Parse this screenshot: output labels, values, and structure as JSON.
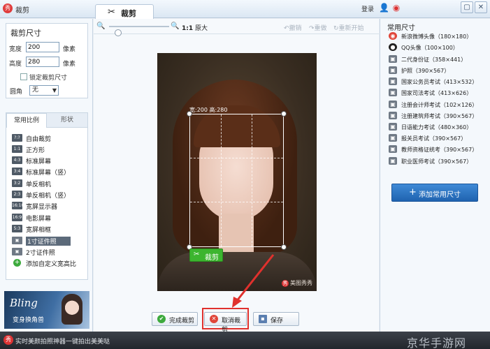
{
  "app": {
    "title": "裁剪",
    "tab_label": "裁剪",
    "login": "登录"
  },
  "size_panel": {
    "title": "裁剪尺寸",
    "width_label": "宽度",
    "width_value": "200",
    "height_label": "高度",
    "height_value": "280",
    "unit": "像素",
    "lock_label": "锁定裁剪尺寸",
    "corner_label": "圆角",
    "corner_value": "无"
  },
  "ratio_panel": {
    "tabs": [
      "常用比例",
      "形状"
    ],
    "items": [
      {
        "icon": "?:?",
        "label": "自由裁剪"
      },
      {
        "icon": "1:1",
        "label": "正方形"
      },
      {
        "icon": "4:3",
        "label": "标准屏幕"
      },
      {
        "icon": "3:4",
        "label": "标准屏幕（竖）"
      },
      {
        "icon": "3:2",
        "label": "单反相机"
      },
      {
        "icon": "2:3",
        "label": "单反相机（竖）"
      },
      {
        "icon": "16:10",
        "label": "宽屏显示器"
      },
      {
        "icon": "16:9",
        "label": "电影屏幕"
      },
      {
        "icon": "5:3",
        "label": "宽屏相框"
      },
      {
        "icon": "",
        "label": "1寸证件照"
      },
      {
        "icon": "",
        "label": "2寸证件照"
      },
      {
        "icon": "+",
        "label": "添加自定义宽高比"
      }
    ]
  },
  "banner": {
    "title": "Bling",
    "subtitle": "变身换角兽"
  },
  "toolbar": {
    "zoom_ratio": "1:1",
    "zoom_text": "原大",
    "undo": "撤销",
    "redo": "重做",
    "reset": "重新开始",
    "zoom_level_fraction": 0.15
  },
  "canvas": {
    "crop_dims": "宽:200  高:280",
    "crop_apply": "裁剪",
    "watermark": "美图秀秀"
  },
  "actions": {
    "done": "完成裁剪",
    "cancel": "取消裁剪",
    "save": "保存"
  },
  "presets": {
    "title": "常用尺寸",
    "items": [
      {
        "label": "新浪微博头像（180×180）",
        "icon_color": "#e0463a"
      },
      {
        "label": "QQ头像（100×100）",
        "icon_color": "#222222"
      },
      {
        "label": "二代身份证（358×441）",
        "icon_color": "#6f7985"
      },
      {
        "label": "护照（390×567）",
        "icon_color": "#6f7985"
      },
      {
        "label": "国家公务员考试（413×532）",
        "icon_color": "#6f7985"
      },
      {
        "label": "国家司法考试（413×626）",
        "icon_color": "#6f7985"
      },
      {
        "label": "注册会计师考试（102×126）",
        "icon_color": "#6f7985"
      },
      {
        "label": "注册建筑师考试（390×567）",
        "icon_color": "#6f7985"
      },
      {
        "label": "日语能力考试（480×360）",
        "icon_color": "#6f7985"
      },
      {
        "label": "报关员考试（390×567）",
        "icon_color": "#6f7985"
      },
      {
        "label": "教师资格证统考（390×567）",
        "icon_color": "#6f7985"
      },
      {
        "label": "职业医师考试（390×567）",
        "icon_color": "#6f7985"
      }
    ],
    "add_button": "添加常用尺寸"
  },
  "status": {
    "text": "实时美颜拍照神器一键拍出美美哒"
  },
  "site_mark": "京华手游网"
}
